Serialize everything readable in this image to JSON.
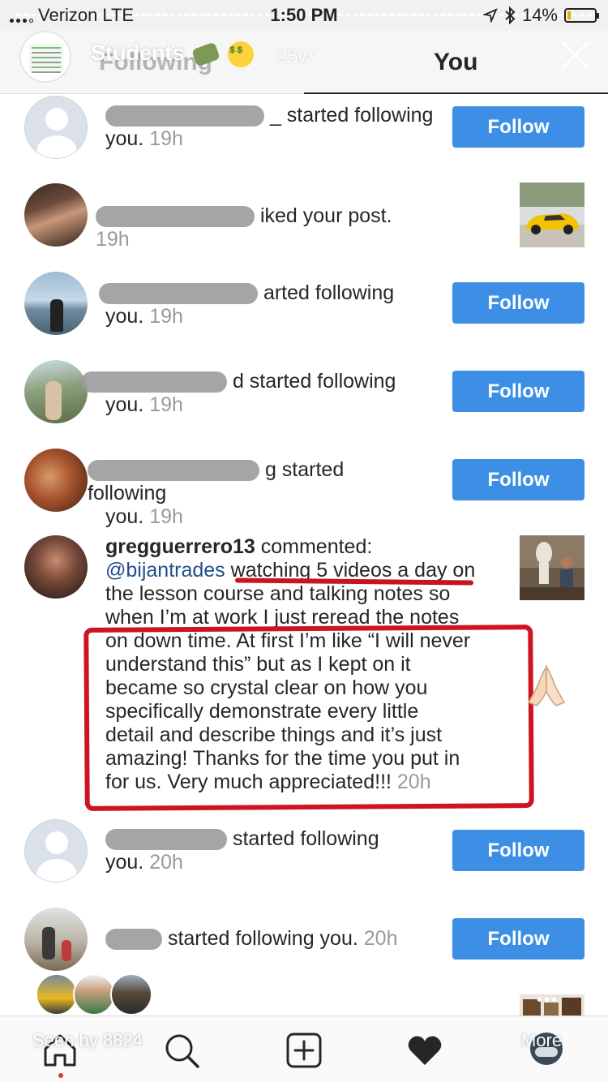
{
  "status_bar": {
    "carrier": "Verizon",
    "network": "LTE",
    "time": "1:50 PM",
    "battery": "14%",
    "battery_level": 0.14
  },
  "story": {
    "name": "Students",
    "age": "25w"
  },
  "tabs": {
    "following": "Following",
    "you": "You"
  },
  "follow_label": "Follow",
  "notifications": [
    {
      "tail": "_ started following",
      "line2": "you.",
      "age": "19h"
    },
    {
      "tail": "iked your post.",
      "age": "19h"
    },
    {
      "tail": "arted following",
      "line2": "you.",
      "age": "19h"
    },
    {
      "tail": "d started following",
      "line2": "you.",
      "age": "19h"
    },
    {
      "tail": "g started following",
      "line2": "you.",
      "age": "19h"
    },
    {
      "tail": "started following",
      "line2": "you.",
      "age": "20h"
    },
    {
      "tail": "started following you.",
      "age": "20h"
    }
  ],
  "comment": {
    "user": "gregguerrero13",
    "verb": "commented:",
    "mention": "@bijantrades",
    "lines": [
      " watching 5 videos a day on",
      "the lesson course and talking notes so",
      "when I’m at work I just reread the notes",
      "on down time. At first I’m like “I will never",
      "understand this” but as I kept on it",
      "became so crystal clear on how you",
      "specifically demonstrate  every little",
      "detail and describe things and it’s just",
      "amazing! Thanks for the time you put in",
      "for us. Very much appreciated!!! "
    ],
    "age": "20h"
  },
  "footer": {
    "seen_by": "Seen by 8824",
    "more": "More",
    "more_dots": "•••"
  },
  "colors": {
    "follow_button": "#3d8fe6",
    "annotation_red": "#d0141f",
    "mention_blue": "#1f4e8c"
  }
}
